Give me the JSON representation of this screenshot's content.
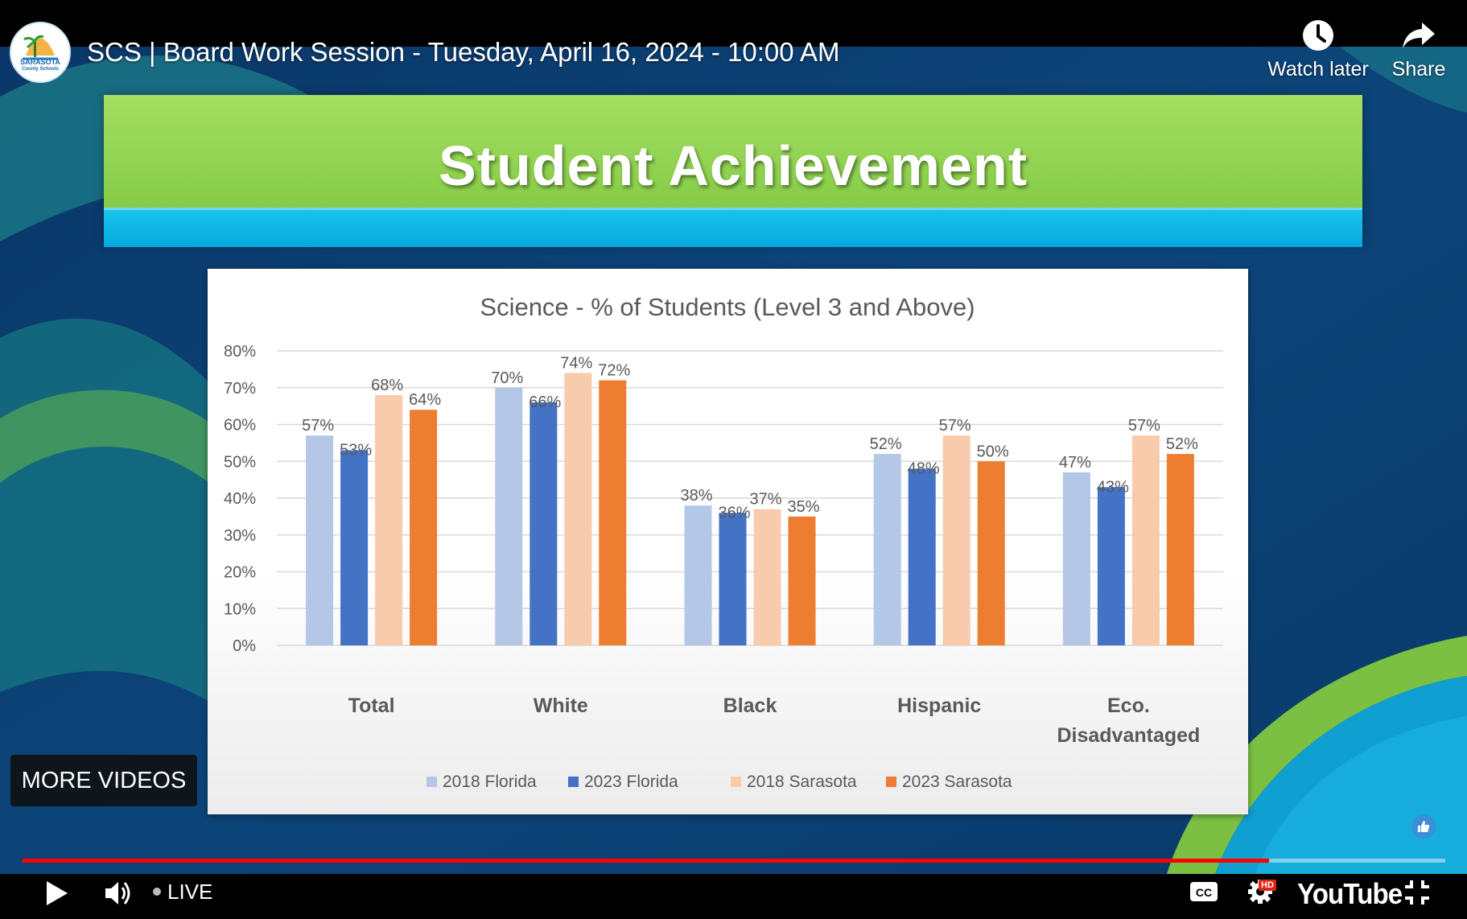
{
  "colors": {
    "bg_dark": "#0b3a6e",
    "bg_teal": "#127a8c",
    "banner_green": "#93d452",
    "banner_blue": "#12b8e6",
    "progress_red": "#ff0000",
    "series_2018_florida": "#b4c7e7",
    "series_2023_florida": "#4472c4",
    "series_2018_sarasota": "#f8cbad",
    "series_2023_sarasota": "#ed7d31"
  },
  "channel": {
    "logo_icon": "palm-tree-logo-icon",
    "logo_line1": "SARASOTA",
    "logo_line2": "County Schools"
  },
  "header": {
    "title": "SCS | Board Work Session - Tuesday, April 16, 2024 - 10:00 AM",
    "watch_later_label": "Watch later",
    "share_label": "Share"
  },
  "slide": {
    "banner_title": "Student Achievement"
  },
  "chart_data": {
    "type": "bar",
    "title": "Science - % of Students (Level 3 and Above)",
    "xlabel": "",
    "ylabel": "",
    "ylim": [
      0,
      80
    ],
    "yticks": [
      "0%",
      "10%",
      "20%",
      "30%",
      "40%",
      "50%",
      "60%",
      "70%",
      "80%"
    ],
    "grid": true,
    "legend_position": "bottom",
    "categories": [
      "Total",
      "White",
      "Black",
      "Hispanic",
      "Eco. Disadvantaged"
    ],
    "category_lines": [
      [
        "Total"
      ],
      [
        "White"
      ],
      [
        "Black"
      ],
      [
        "Hispanic"
      ],
      [
        "Eco.",
        "Disadvantaged"
      ]
    ],
    "series": [
      {
        "name": "2018 Florida",
        "color": "#b4c7e7",
        "values": [
          57,
          70,
          38,
          52,
          47
        ],
        "labels": [
          "57%",
          "70%",
          "38%",
          "52%",
          "47%"
        ]
      },
      {
        "name": "2023 Florida",
        "color": "#4472c4",
        "values": [
          53,
          66,
          36,
          48,
          43
        ],
        "labels": [
          "53%",
          "66%",
          "36%",
          "48%",
          "43%"
        ]
      },
      {
        "name": "2018 Sarasota",
        "color": "#f8cbad",
        "values": [
          68,
          74,
          37,
          57,
          57
        ],
        "labels": [
          "68%",
          "74%",
          "37%",
          "57%",
          "57%"
        ]
      },
      {
        "name": "2023 Sarasota",
        "color": "#ed7d31",
        "values": [
          64,
          72,
          35,
          50,
          52
        ],
        "labels": [
          "64%",
          "72%",
          "35%",
          "50%",
          "52%"
        ]
      }
    ]
  },
  "overlay": {
    "more_videos_label": "MORE VIDEOS"
  },
  "player": {
    "progress_fraction": 0.876,
    "live_label": "LIVE",
    "hd_badge": "HD",
    "youtube_label": "YouTube",
    "icons": {
      "play": "play-icon",
      "volume": "volume-icon",
      "captions": "captions-icon",
      "settings": "settings-gear-icon",
      "exit_fullscreen": "exit-fullscreen-icon",
      "watch_later": "clock-icon",
      "share": "share-arrow-icon",
      "like": "thumbs-up-icon"
    }
  }
}
